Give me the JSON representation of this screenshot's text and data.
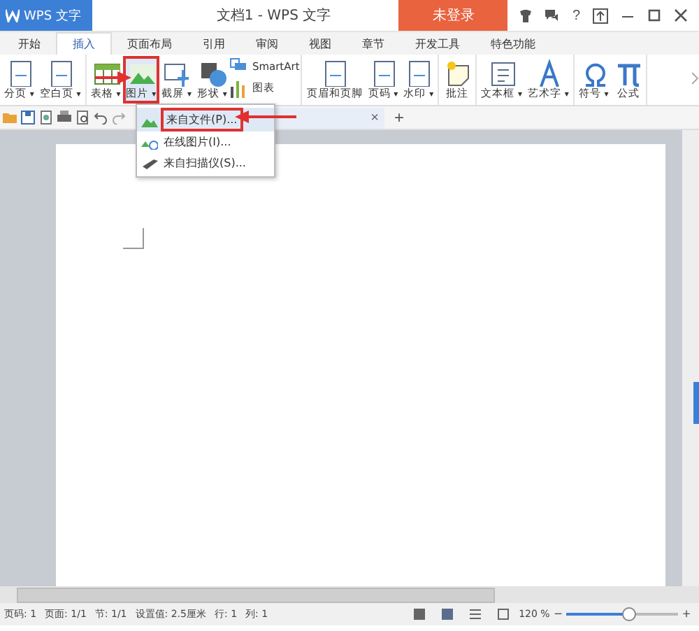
{
  "app_button": {
    "label": "WPS 文字"
  },
  "window": {
    "title": "文档1 - WPS 文字"
  },
  "login_button": {
    "label": "未登录"
  },
  "help_button": {
    "label": "?"
  },
  "tabs": [
    {
      "label": "开始",
      "selected": false
    },
    {
      "label": "插入",
      "selected": true
    },
    {
      "label": "页面布局",
      "selected": false
    },
    {
      "label": "引用",
      "selected": false
    },
    {
      "label": "审阅",
      "selected": false
    },
    {
      "label": "视图",
      "selected": false
    },
    {
      "label": "章节",
      "selected": false
    },
    {
      "label": "开发工具",
      "selected": false
    },
    {
      "label": "特色功能",
      "selected": false
    }
  ],
  "ribbon": [
    [
      {
        "label": "分页",
        "dropdown": true,
        "kind": "large",
        "selected": false
      },
      {
        "label": "空白页",
        "dropdown": true,
        "kind": "large",
        "selected": false
      }
    ],
    [
      {
        "label": "表格",
        "dropdown": true,
        "kind": "large",
        "selected": false
      },
      {
        "label": "图片",
        "dropdown": true,
        "kind": "large",
        "selected": true
      },
      {
        "label": "截屏",
        "dropdown": true,
        "kind": "large",
        "selected": false
      },
      {
        "label": "形状",
        "dropdown": true,
        "kind": "large",
        "selected": false
      },
      {
        "label": "SmartArt",
        "dropdown": false,
        "kind": "small",
        "selected": false
      },
      {
        "label": "图表",
        "dropdown": false,
        "kind": "small",
        "selected": false
      }
    ],
    [
      {
        "label": "页眉和页脚",
        "dropdown": false,
        "kind": "large",
        "selected": false
      },
      {
        "label": "页码",
        "dropdown": true,
        "kind": "large",
        "selected": false
      },
      {
        "label": "水印",
        "dropdown": true,
        "kind": "large",
        "selected": false
      }
    ],
    [
      {
        "label": "批注",
        "dropdown": false,
        "kind": "large",
        "selected": false
      }
    ],
    [
      {
        "label": "文本框",
        "dropdown": true,
        "kind": "large",
        "selected": false
      },
      {
        "label": "艺术字",
        "dropdown": true,
        "kind": "large",
        "selected": false
      }
    ],
    [
      {
        "label": "符号",
        "dropdown": true,
        "kind": "large",
        "selected": false
      },
      {
        "label": "公式",
        "dropdown": false,
        "kind": "large",
        "selected": false
      }
    ]
  ],
  "dropdown_arrow": "▾",
  "menu": [
    {
      "label": "来自文件(P)...",
      "selected": true
    },
    {
      "label": "在线图片(I)...",
      "selected": false
    },
    {
      "label": "来自扫描仪(S)...",
      "selected": false
    }
  ],
  "document_tab": {
    "close": "×",
    "new": "+"
  },
  "status_bar": [
    "页码: 1",
    "页面: 1/1",
    "节: 1/1",
    "设置值: 2.5厘米",
    "行: 1",
    "列: 1"
  ],
  "zoom": {
    "reading": "120 %",
    "minus": "−",
    "plus": "+",
    "level": 0.55
  }
}
